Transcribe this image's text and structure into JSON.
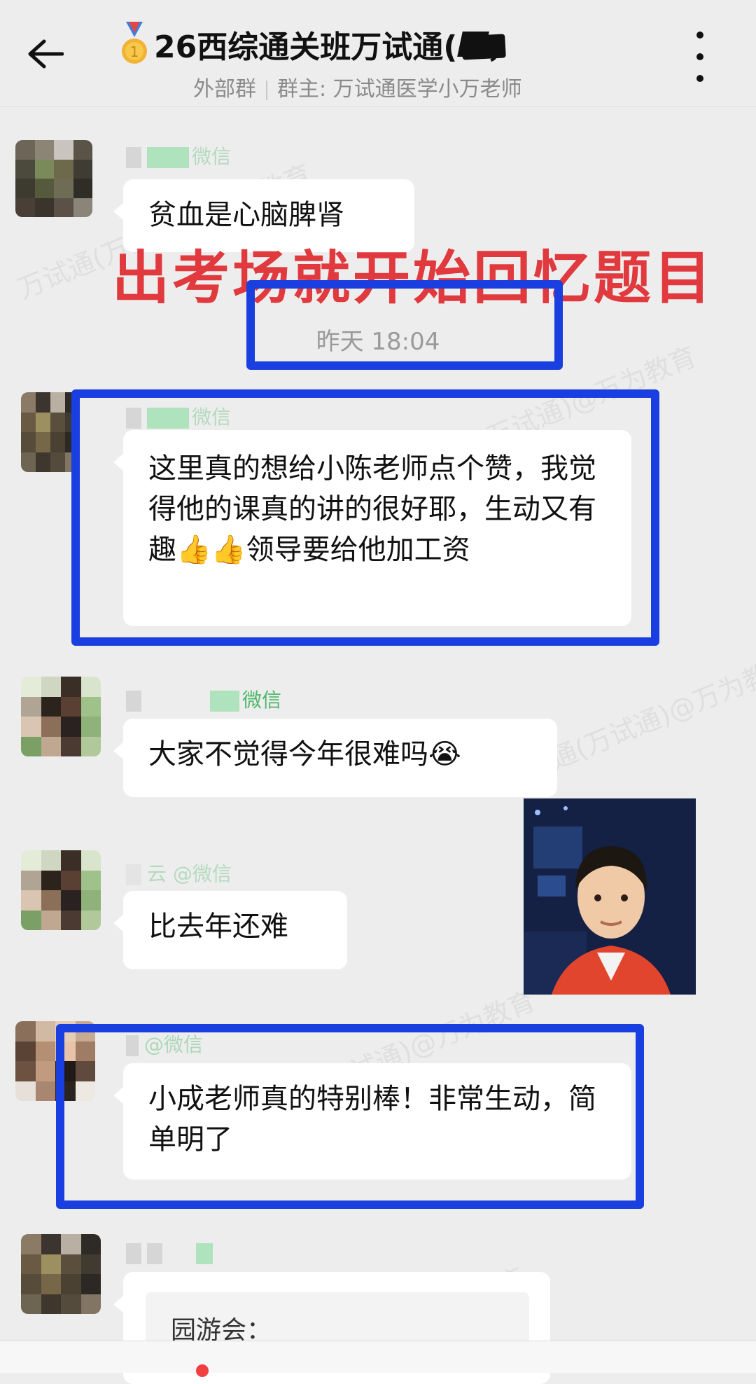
{
  "header": {
    "title": "26西综通关班万试通(",
    "title_suffix": "，",
    "subtitle_left": "外部群",
    "subtitle_right": "群主: 万试通医学小万老师"
  },
  "overlay_caption": "出考场就开始回忆题目",
  "timestamp": "昨天 18:04",
  "messages": [
    {
      "sender": "微信",
      "text": "贫血是心脑脾肾"
    },
    {
      "sender": "微信",
      "text": "这里真的想给小陈老师点个赞，我觉得他的课真的讲的很好耶，生动又有趣👍👍领导要给他加工资"
    },
    {
      "sender": "微信",
      "text": "大家不觉得今年很难吗😭"
    },
    {
      "sender": "云 @微信",
      "text": "比去年还难"
    },
    {
      "sender": "@微信",
      "text": "小成老师真的特别棒！非常生动，简单明了"
    },
    {
      "sender": "",
      "text": "园游会："
    }
  ],
  "watermarks": [
    "万试通(万试通)@万为教育",
    "万试通(万试通)@万为教育",
    "万试通(万试通)@万为教育",
    "万试通(万试通)@万为教育",
    "万为教育"
  ],
  "colors": {
    "background": "#ededed",
    "bubble": "#ffffff",
    "overlay_red": "#e0393e",
    "highlight_blue": "#1a3fe0",
    "sender_green": "#4db86a"
  },
  "icons": {
    "back": "arrow-left-icon",
    "more": "more-vertical-icon",
    "medal": "medal-icon"
  }
}
